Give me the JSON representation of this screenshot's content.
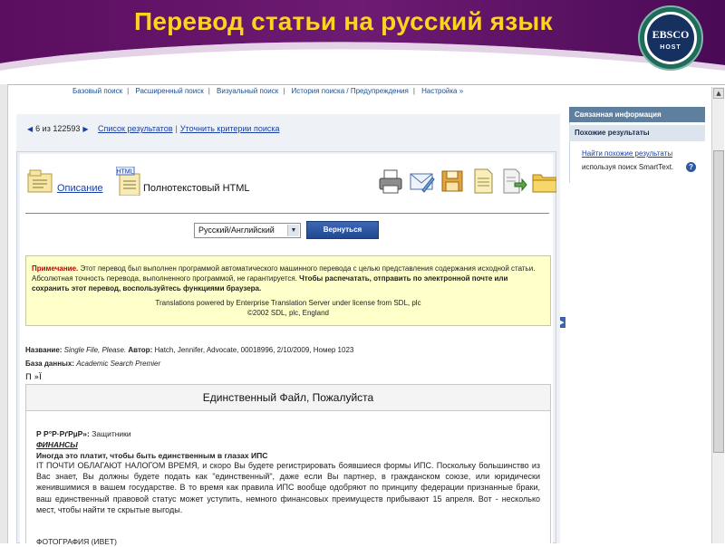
{
  "slide": {
    "title": "Перевод статьи на русский язык",
    "logo_text": "EBSCO",
    "logo_sub": "HOST"
  },
  "topnav": {
    "items": [
      "Базовый поиск",
      "Расширенный поиск",
      "Визуальный поиск",
      "История поиска / Предупреждения",
      "Настройка »"
    ]
  },
  "pager": {
    "position": "6 из 122593",
    "results_link": "Список результатов",
    "refine_link": "Уточнить критерии поиска"
  },
  "tabs": {
    "description": "Описание",
    "fulltext": "Полнотекстовый HTML",
    "html_badge": "HTML"
  },
  "language": {
    "selected": "Русский/Английский",
    "back_button": "Вернуться"
  },
  "note": {
    "label": "Примечание.",
    "text1": " Этот перевод был выполнен программой автоматического машинного перевода с целью представления содержания исходной статьи. Абсолютная точность перевода, выполненного программой, не гарантируется. ",
    "bold_text": "Чтобы распечатать, отправить по электронной почте или сохранить этот перевод, воспользуйтесь функциями браузера.",
    "powered": "Translations powered by Enterprise Translation Server under license from SDL, plc",
    "copyright": "©2002 SDL, plc, England"
  },
  "meta": {
    "title_label": "Название:",
    "title_value": "Single File, Please.",
    "author_label": "Автор:",
    "author_value": "Hatch, Jennifer, Advocate, 00018996, 2/10/2009, Номер 1023",
    "db_label": "База данных:",
    "db_value": "Academic Search Premier"
  },
  "article": {
    "glyphs": "П »Ї",
    "title": "Единственный Файл, Пожалуйста",
    "section_prefix": "Р Р°Р·РґРµР»:",
    "section_value": " Защитники",
    "category": "ФИНАНСЫ",
    "headline": "Иногда это платит, чтобы быть единственным в глазах ИПС",
    "paragraph": "IT ПОЧТИ ОБЛАГАЮТ НАЛОГОМ ВРЕМЯ, и скоро Вы будете регистрировать боявшиеся формы ИПС. Поскольку большинство из Вас знает, Вы должны будете подать как \"единственный\", даже если Вы партнер, в гражданском союзе, или юридически женившимися в вашем государстве. В то время как правила ИПС вообще одобряют по принципу федерации признанные браки, ваш единственный правовой статус может уступить, немного финансовых преимуществ прибывают 15 апреля. Вот - несколько мест, чтобы найти те скрытые выгоды.",
    "next_line": "ФОТОГРАФИЯ (ИВЕТ)"
  },
  "sidebar": {
    "header": "Связанная информация",
    "subheader": "Похожие результаты",
    "link": "Найти похожие результаты",
    "text": "используя поиск SmartText.",
    "help": "?"
  },
  "icons": [
    "description-icon",
    "html-icon",
    "print-icon",
    "email-icon",
    "save-icon",
    "cite-icon",
    "export-icon",
    "folder-icon"
  ]
}
